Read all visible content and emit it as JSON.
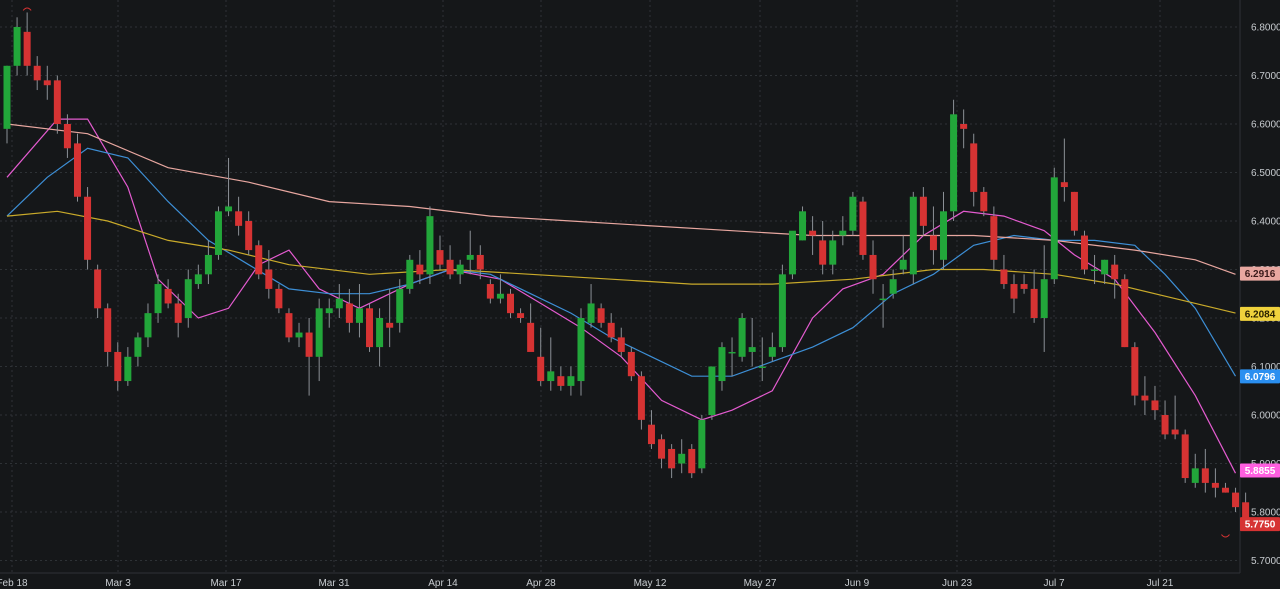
{
  "chart_data": {
    "type": "candlestick",
    "grid": true,
    "ylim": [
      5.69,
      6.84
    ],
    "y_ticks": [
      "6.8000",
      "6.7000",
      "6.6000",
      "6.5000",
      "6.4000",
      "6.3000",
      "6.2000",
      "6.1000",
      "6.0000",
      "5.9000",
      "5.8000",
      "5.7000"
    ],
    "x_ticks": [
      "Feb 18",
      "Mar 3",
      "Mar 17",
      "Mar 31",
      "Apr 14",
      "Apr 28",
      "May 12",
      "May 27",
      "Jun 9",
      "Jun 23",
      "Jul 7",
      "Jul 21"
    ],
    "colors": {
      "background": "#151719",
      "grid": "#2e3236",
      "up": "#22a63a",
      "down": "#d63333",
      "text": "#c8ccd0"
    },
    "candles": [
      [
        6.59,
        6.72,
        6.56,
        6.72
      ],
      [
        6.72,
        6.82,
        6.7,
        6.8
      ],
      [
        6.79,
        6.83,
        6.7,
        6.72
      ],
      [
        6.72,
        6.74,
        6.67,
        6.69
      ],
      [
        6.69,
        6.72,
        6.65,
        6.68
      ],
      [
        6.69,
        6.7,
        6.58,
        6.6
      ],
      [
        6.6,
        6.62,
        6.53,
        6.55
      ],
      [
        6.56,
        6.58,
        6.44,
        6.45
      ],
      [
        6.45,
        6.47,
        6.3,
        6.32
      ],
      [
        6.3,
        6.31,
        6.2,
        6.22
      ],
      [
        6.22,
        6.23,
        6.1,
        6.13
      ],
      [
        6.13,
        6.15,
        6.05,
        6.07
      ],
      [
        6.07,
        6.14,
        6.06,
        6.12
      ],
      [
        6.12,
        6.17,
        6.1,
        6.16
      ],
      [
        6.16,
        6.23,
        6.14,
        6.21
      ],
      [
        6.21,
        6.29,
        6.19,
        6.27
      ],
      [
        6.26,
        6.28,
        6.22,
        6.23
      ],
      [
        6.23,
        6.25,
        6.16,
        6.19
      ],
      [
        6.2,
        6.3,
        6.18,
        6.28
      ],
      [
        6.27,
        6.31,
        6.26,
        6.29
      ],
      [
        6.29,
        6.36,
        6.27,
        6.33
      ],
      [
        6.33,
        6.43,
        6.32,
        6.42
      ],
      [
        6.42,
        6.53,
        6.41,
        6.43
      ],
      [
        6.42,
        6.45,
        6.37,
        6.39
      ],
      [
        6.4,
        6.42,
        6.33,
        6.34
      ],
      [
        6.35,
        6.36,
        6.28,
        6.29
      ],
      [
        6.3,
        6.34,
        6.24,
        6.26
      ],
      [
        6.26,
        6.27,
        6.21,
        6.22
      ],
      [
        6.21,
        6.22,
        6.15,
        6.16
      ],
      [
        6.16,
        6.19,
        6.14,
        6.17
      ],
      [
        6.17,
        6.2,
        6.04,
        6.12
      ],
      [
        6.12,
        6.24,
        6.07,
        6.22
      ],
      [
        6.21,
        6.24,
        6.18,
        6.22
      ],
      [
        6.22,
        6.27,
        6.2,
        6.24
      ],
      [
        6.23,
        6.26,
        6.17,
        6.19
      ],
      [
        6.19,
        6.27,
        6.16,
        6.22
      ],
      [
        6.22,
        6.23,
        6.13,
        6.14
      ],
      [
        6.14,
        6.22,
        6.1,
        6.2
      ],
      [
        6.19,
        6.26,
        6.14,
        6.18
      ],
      [
        6.19,
        6.28,
        6.17,
        6.26
      ],
      [
        6.26,
        6.33,
        6.25,
        6.32
      ],
      [
        6.31,
        6.34,
        6.27,
        6.29
      ],
      [
        6.29,
        6.43,
        6.27,
        6.41
      ],
      [
        6.34,
        6.37,
        6.3,
        6.31
      ],
      [
        6.32,
        6.35,
        6.28,
        6.29
      ],
      [
        6.29,
        6.32,
        6.27,
        6.31
      ],
      [
        6.32,
        6.38,
        6.29,
        6.33
      ],
      [
        6.33,
        6.35,
        6.28,
        6.3
      ],
      [
        6.27,
        6.28,
        6.23,
        6.24
      ],
      [
        6.24,
        6.29,
        6.23,
        6.25
      ],
      [
        6.25,
        6.26,
        6.2,
        6.21
      ],
      [
        6.21,
        6.22,
        6.19,
        6.2
      ],
      [
        6.19,
        6.23,
        6.14,
        6.13
      ],
      [
        6.12,
        6.18,
        6.06,
        6.07
      ],
      [
        6.07,
        6.16,
        6.05,
        6.09
      ],
      [
        6.08,
        6.1,
        6.05,
        6.06
      ],
      [
        6.06,
        6.1,
        6.04,
        6.08
      ],
      [
        6.07,
        6.22,
        6.04,
        6.2
      ],
      [
        6.19,
        6.27,
        6.18,
        6.23
      ],
      [
        6.22,
        6.23,
        6.18,
        6.19
      ],
      [
        6.19,
        6.21,
        6.15,
        6.16
      ],
      [
        6.16,
        6.18,
        6.12,
        6.13
      ],
      [
        6.13,
        6.14,
        6.07,
        6.08
      ],
      [
        6.08,
        6.09,
        5.97,
        5.99
      ],
      [
        5.98,
        6.01,
        5.93,
        5.94
      ],
      [
        5.95,
        5.96,
        5.89,
        5.91
      ],
      [
        5.93,
        5.94,
        5.87,
        5.89
      ],
      [
        5.9,
        5.95,
        5.88,
        5.92
      ],
      [
        5.93,
        5.94,
        5.87,
        5.88
      ],
      [
        5.89,
        6.0,
        5.88,
        5.99
      ],
      [
        6.0,
        6.1,
        5.99,
        6.1
      ],
      [
        6.07,
        6.15,
        6.05,
        6.14
      ],
      [
        6.13,
        6.16,
        6.08,
        6.13
      ],
      [
        6.12,
        6.21,
        6.11,
        6.2
      ],
      [
        6.13,
        6.2,
        6.1,
        6.14
      ],
      [
        6.1,
        6.16,
        6.07,
        6.1
      ],
      [
        6.12,
        6.17,
        6.11,
        6.14
      ],
      [
        6.14,
        6.31,
        6.13,
        6.29
      ],
      [
        6.29,
        6.36,
        6.28,
        6.38
      ],
      [
        6.36,
        6.43,
        6.36,
        6.42
      ],
      [
        6.38,
        6.41,
        6.33,
        6.37
      ],
      [
        6.36,
        6.4,
        6.29,
        6.31
      ],
      [
        6.31,
        6.38,
        6.29,
        6.36
      ],
      [
        6.37,
        6.41,
        6.35,
        6.38
      ],
      [
        6.38,
        6.46,
        6.37,
        6.45
      ],
      [
        6.44,
        6.45,
        6.32,
        6.33
      ],
      [
        6.33,
        6.36,
        6.25,
        6.28
      ],
      [
        6.24,
        6.27,
        6.18,
        6.24
      ],
      [
        6.25,
        6.3,
        6.24,
        6.28
      ],
      [
        6.3,
        6.37,
        6.29,
        6.32
      ],
      [
        6.29,
        6.46,
        6.27,
        6.45
      ],
      [
        6.45,
        6.47,
        6.37,
        6.39
      ],
      [
        6.37,
        6.43,
        6.31,
        6.34
      ],
      [
        6.32,
        6.46,
        6.3,
        6.42
      ],
      [
        6.42,
        6.65,
        6.4,
        6.62
      ],
      [
        6.6,
        6.63,
        6.55,
        6.59
      ],
      [
        6.56,
        6.58,
        6.43,
        6.46
      ],
      [
        6.46,
        6.47,
        6.41,
        6.42
      ],
      [
        6.41,
        6.43,
        6.3,
        6.32
      ],
      [
        6.3,
        6.33,
        6.26,
        6.27
      ],
      [
        6.27,
        6.29,
        6.21,
        6.24
      ],
      [
        6.27,
        6.29,
        6.25,
        6.26
      ],
      [
        6.26,
        6.3,
        6.19,
        6.2
      ],
      [
        6.2,
        6.35,
        6.13,
        6.28
      ],
      [
        6.28,
        6.51,
        6.27,
        6.49
      ],
      [
        6.48,
        6.57,
        6.44,
        6.47
      ],
      [
        6.46,
        6.46,
        6.37,
        6.38
      ],
      [
        6.37,
        6.38,
        6.29,
        6.3
      ],
      [
        6.3,
        6.33,
        6.27,
        6.3
      ],
      [
        6.29,
        6.32,
        6.27,
        6.32
      ],
      [
        6.31,
        6.33,
        6.24,
        6.28
      ],
      [
        6.28,
        6.29,
        6.14,
        6.14
      ],
      [
        6.14,
        6.15,
        6.02,
        6.04
      ],
      [
        6.04,
        6.08,
        6.0,
        6.03
      ],
      [
        6.03,
        6.06,
        5.99,
        6.01
      ],
      [
        6.0,
        6.03,
        5.95,
        5.96
      ],
      [
        5.97,
        6.04,
        5.95,
        5.96
      ],
      [
        5.96,
        5.97,
        5.86,
        5.87
      ],
      [
        5.86,
        5.92,
        5.85,
        5.89
      ],
      [
        5.89,
        5.93,
        5.84,
        5.86
      ],
      [
        5.86,
        5.89,
        5.83,
        5.85
      ],
      [
        5.85,
        5.86,
        5.84,
        5.84
      ],
      [
        5.84,
        5.85,
        5.8,
        5.81
      ],
      [
        5.82,
        5.84,
        5.77,
        5.78
      ]
    ],
    "moving_averages": [
      {
        "color": "#e45bd0",
        "last": "5.8855",
        "points": [
          [
            0,
            6.49
          ],
          [
            5,
            6.61
          ],
          [
            8,
            6.61
          ],
          [
            12,
            6.47
          ],
          [
            15,
            6.28
          ],
          [
            19,
            6.2
          ],
          [
            22,
            6.22
          ],
          [
            25,
            6.31
          ],
          [
            28,
            6.34
          ],
          [
            31,
            6.26
          ],
          [
            35,
            6.22
          ],
          [
            40,
            6.27
          ],
          [
            44,
            6.3
          ],
          [
            49,
            6.28
          ],
          [
            53,
            6.23
          ],
          [
            57,
            6.18
          ],
          [
            61,
            6.12
          ],
          [
            65,
            6.03
          ],
          [
            69,
            5.99
          ],
          [
            72,
            6.01
          ],
          [
            76,
            6.05
          ],
          [
            80,
            6.2
          ],
          [
            83,
            6.26
          ],
          [
            87,
            6.29
          ],
          [
            91,
            6.37
          ],
          [
            95,
            6.42
          ],
          [
            99,
            6.41
          ],
          [
            103,
            6.38
          ],
          [
            106,
            6.33
          ],
          [
            110,
            6.28
          ],
          [
            114,
            6.17
          ],
          [
            118,
            6.04
          ],
          [
            122,
            5.88
          ]
        ]
      },
      {
        "color": "#3d8fd6",
        "last": "6.0796",
        "points": [
          [
            0,
            6.41
          ],
          [
            4,
            6.49
          ],
          [
            8,
            6.55
          ],
          [
            12,
            6.53
          ],
          [
            16,
            6.44
          ],
          [
            20,
            6.36
          ],
          [
            24,
            6.31
          ],
          [
            28,
            6.26
          ],
          [
            32,
            6.25
          ],
          [
            36,
            6.25
          ],
          [
            40,
            6.27
          ],
          [
            44,
            6.3
          ],
          [
            48,
            6.29
          ],
          [
            52,
            6.25
          ],
          [
            56,
            6.21
          ],
          [
            60,
            6.16
          ],
          [
            64,
            6.12
          ],
          [
            68,
            6.08
          ],
          [
            72,
            6.08
          ],
          [
            76,
            6.11
          ],
          [
            80,
            6.14
          ],
          [
            84,
            6.18
          ],
          [
            88,
            6.25
          ],
          [
            92,
            6.29
          ],
          [
            96,
            6.35
          ],
          [
            100,
            6.37
          ],
          [
            104,
            6.36
          ],
          [
            108,
            6.36
          ],
          [
            112,
            6.35
          ],
          [
            115,
            6.29
          ],
          [
            118,
            6.22
          ],
          [
            122,
            6.08
          ]
        ]
      },
      {
        "color": "#c9aa2a",
        "last": "6.2084",
        "points": [
          [
            0,
            6.41
          ],
          [
            5,
            6.42
          ],
          [
            10,
            6.4
          ],
          [
            16,
            6.36
          ],
          [
            22,
            6.34
          ],
          [
            28,
            6.31
          ],
          [
            36,
            6.29
          ],
          [
            44,
            6.3
          ],
          [
            52,
            6.29
          ],
          [
            60,
            6.28
          ],
          [
            68,
            6.27
          ],
          [
            76,
            6.27
          ],
          [
            84,
            6.28
          ],
          [
            92,
            6.3
          ],
          [
            97,
            6.3
          ],
          [
            104,
            6.29
          ],
          [
            110,
            6.27
          ],
          [
            116,
            6.24
          ],
          [
            122,
            6.21
          ]
        ]
      },
      {
        "color": "#e8a7a0",
        "last": "6.2916",
        "points": [
          [
            0,
            6.6
          ],
          [
            8,
            6.58
          ],
          [
            16,
            6.51
          ],
          [
            24,
            6.48
          ],
          [
            32,
            6.44
          ],
          [
            40,
            6.43
          ],
          [
            48,
            6.41
          ],
          [
            56,
            6.4
          ],
          [
            64,
            6.39
          ],
          [
            72,
            6.38
          ],
          [
            80,
            6.37
          ],
          [
            88,
            6.37
          ],
          [
            96,
            6.37
          ],
          [
            104,
            6.36
          ],
          [
            112,
            6.34
          ],
          [
            118,
            6.32
          ],
          [
            122,
            6.29
          ]
        ]
      }
    ],
    "last_price": {
      "value": "5.7750",
      "color": "#d63333"
    }
  }
}
